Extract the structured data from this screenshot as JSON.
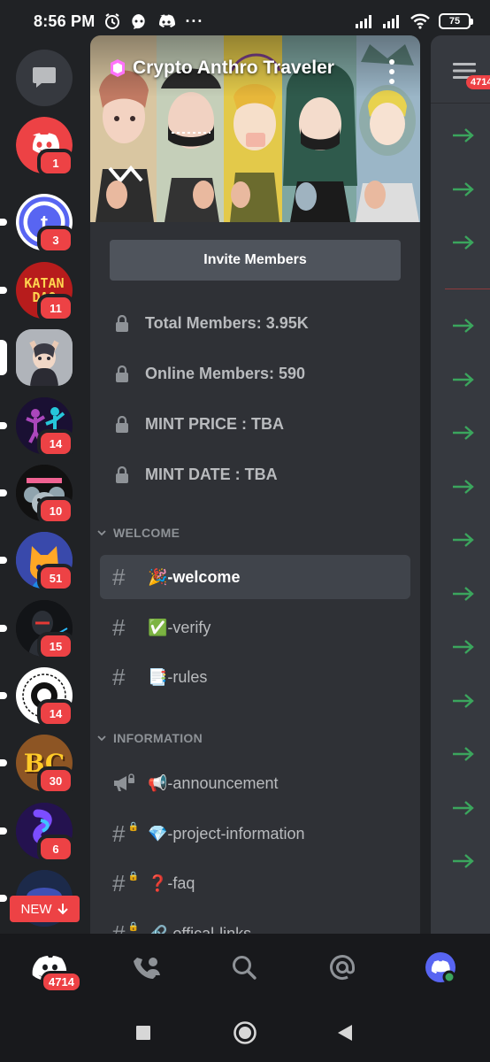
{
  "status_bar": {
    "time": "8:56 PM",
    "dots": "···",
    "battery": "75"
  },
  "servers": [
    {
      "name": "home",
      "icon": "chat-bubble-icon"
    },
    {
      "name": "discord",
      "badge": "1",
      "color": "#ed4245"
    },
    {
      "name": "t-server",
      "badge": "3",
      "color": "#5865f2"
    },
    {
      "name": "katan-dao",
      "badge": "11",
      "color": "#c62828",
      "label": "KATAN DAO"
    },
    {
      "name": "crypto-anthro-traveler",
      "badge": "",
      "color": "#9aa0a6",
      "selected": true
    },
    {
      "name": "dance-server",
      "badge": "14",
      "color": "#6a1b9a"
    },
    {
      "name": "bubbly-koala",
      "badge": "10",
      "color": "#ad1457"
    },
    {
      "name": "cat-server",
      "badge": "51",
      "color": "#283593"
    },
    {
      "name": "robot-server",
      "badge": "15",
      "color": "#212121"
    },
    {
      "name": "octiverse",
      "badge": "14",
      "color": "#ffffff",
      "label": "OCTIVERSE"
    },
    {
      "name": "bc-server",
      "badge": "30",
      "color": "#8d5524",
      "label": "BC"
    },
    {
      "name": "gradient-server",
      "badge": "6",
      "color": "#311b92"
    }
  ],
  "new_pill": {
    "label": "NEW"
  },
  "server": {
    "name": "Crypto Anthro Traveler",
    "invite_label": "Invite Members"
  },
  "stats": [
    {
      "label": "Total Members: 3.95K"
    },
    {
      "label": "Online Members: 590"
    },
    {
      "label": "MINT PRICE : TBA"
    },
    {
      "label": "MINT DATE : TBA"
    }
  ],
  "categories": {
    "welcome": {
      "label": "WELCOME",
      "channels": [
        {
          "emoji": "🎉",
          "name": "-welcome",
          "active": true
        },
        {
          "emoji": "✅",
          "name": "-verify"
        },
        {
          "emoji": "📑",
          "name": "-rules"
        }
      ]
    },
    "information": {
      "label": "INFORMATION",
      "channels": [
        {
          "emoji": "📢",
          "name": "-announcement",
          "type": "announcement"
        },
        {
          "emoji": "💎",
          "name": "-project-information",
          "type": "locked"
        },
        {
          "emoji": "❓",
          "name": "-faq",
          "type": "locked"
        },
        {
          "emoji": "🔗",
          "name": "-offical-links",
          "type": "locked"
        }
      ]
    }
  },
  "chat": {
    "mention_badge": "4714"
  },
  "bottom_nav": {
    "home_badge": "4714"
  },
  "colors": {
    "accent": "#5865f2",
    "danger": "#ed4245",
    "reply_arrow": "#3ba55d"
  }
}
